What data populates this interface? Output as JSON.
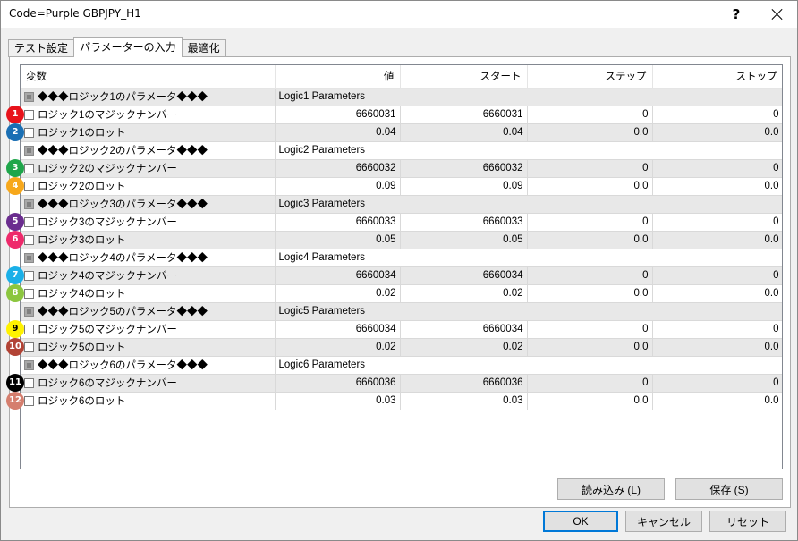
{
  "window": {
    "title": "Code=Purple GBPJPY_H1",
    "help_label": "?"
  },
  "tabs": [
    {
      "label": "テスト設定",
      "active": false
    },
    {
      "label": "パラメーターの入力",
      "active": true
    },
    {
      "label": "最適化",
      "active": false
    }
  ],
  "grid": {
    "columns": [
      "変数",
      "値",
      "スタート",
      "ステップ",
      "ストップ"
    ],
    "rows": [
      {
        "type": "group",
        "name": "◆◆◆ロジック1のパラメータ◆◆◆",
        "label": "Logic1 Parameters"
      },
      {
        "type": "param",
        "badge": "1",
        "badge_color": "#e8131b",
        "name": "ロジック1のマジックナンバー",
        "value": "6660031",
        "start": "6660031",
        "step": "0",
        "stop": "0"
      },
      {
        "type": "param",
        "badge": "2",
        "badge_color": "#1a6fb4",
        "name": "ロジック1のロット",
        "value": "0.04",
        "start": "0.04",
        "step": "0.0",
        "stop": "0.0"
      },
      {
        "type": "group",
        "name": "◆◆◆ロジック2のパラメータ◆◆◆",
        "label": "Logic2 Parameters"
      },
      {
        "type": "param",
        "badge": "3",
        "badge_color": "#1fa64b",
        "name": "ロジック2のマジックナンバー",
        "value": "6660032",
        "start": "6660032",
        "step": "0",
        "stop": "0"
      },
      {
        "type": "param",
        "badge": "4",
        "badge_color": "#f7a81b",
        "name": "ロジック2のロット",
        "value": "0.09",
        "start": "0.09",
        "step": "0.0",
        "stop": "0.0"
      },
      {
        "type": "group",
        "name": "◆◆◆ロジック3のパラメータ◆◆◆",
        "label": "Logic3 Parameters"
      },
      {
        "type": "param",
        "badge": "5",
        "badge_color": "#6b2d8f",
        "name": "ロジック3のマジックナンバー",
        "value": "6660033",
        "start": "6660033",
        "step": "0",
        "stop": "0"
      },
      {
        "type": "param",
        "badge": "6",
        "badge_color": "#ee2a6b",
        "name": "ロジック3のロット",
        "value": "0.05",
        "start": "0.05",
        "step": "0.0",
        "stop": "0.0"
      },
      {
        "type": "group",
        "name": "◆◆◆ロジック4のパラメータ◆◆◆",
        "label": "Logic4 Parameters"
      },
      {
        "type": "param",
        "badge": "7",
        "badge_color": "#1bb0e8",
        "name": "ロジック4のマジックナンバー",
        "value": "6660034",
        "start": "6660034",
        "step": "0",
        "stop": "0"
      },
      {
        "type": "param",
        "badge": "8",
        "badge_color": "#8cc63f",
        "name": "ロジック4のロット",
        "value": "0.02",
        "start": "0.02",
        "step": "0.0",
        "stop": "0.0"
      },
      {
        "type": "group",
        "name": "◆◆◆ロジック5のパラメータ◆◆◆",
        "label": "Logic5 Parameters"
      },
      {
        "type": "param",
        "badge": "9",
        "badge_color": "#fff200",
        "badge_text": "#000000",
        "name": "ロジック5のマジックナンバー",
        "value": "6660034",
        "start": "6660034",
        "step": "0",
        "stop": "0"
      },
      {
        "type": "param",
        "badge": "10",
        "badge_color": "#b24335",
        "name": "ロジック5のロット",
        "value": "0.02",
        "start": "0.02",
        "step": "0.0",
        "stop": "0.0"
      },
      {
        "type": "group",
        "name": "◆◆◆ロジック6のパラメータ◆◆◆",
        "label": "Logic6 Parameters"
      },
      {
        "type": "param",
        "badge": "11",
        "badge_color": "#000000",
        "name": "ロジック6のマジックナンバー",
        "value": "6660036",
        "start": "6660036",
        "step": "0",
        "stop": "0"
      },
      {
        "type": "param",
        "badge": "12",
        "badge_color": "#d57e6e",
        "name": "ロジック6のロット",
        "value": "0.03",
        "start": "0.03",
        "step": "0.0",
        "stop": "0.0"
      }
    ]
  },
  "buttons": {
    "load": "読み込み (L)",
    "save": "保存 (S)",
    "ok": "OK",
    "cancel": "キャンセル",
    "reset": "リセット"
  }
}
